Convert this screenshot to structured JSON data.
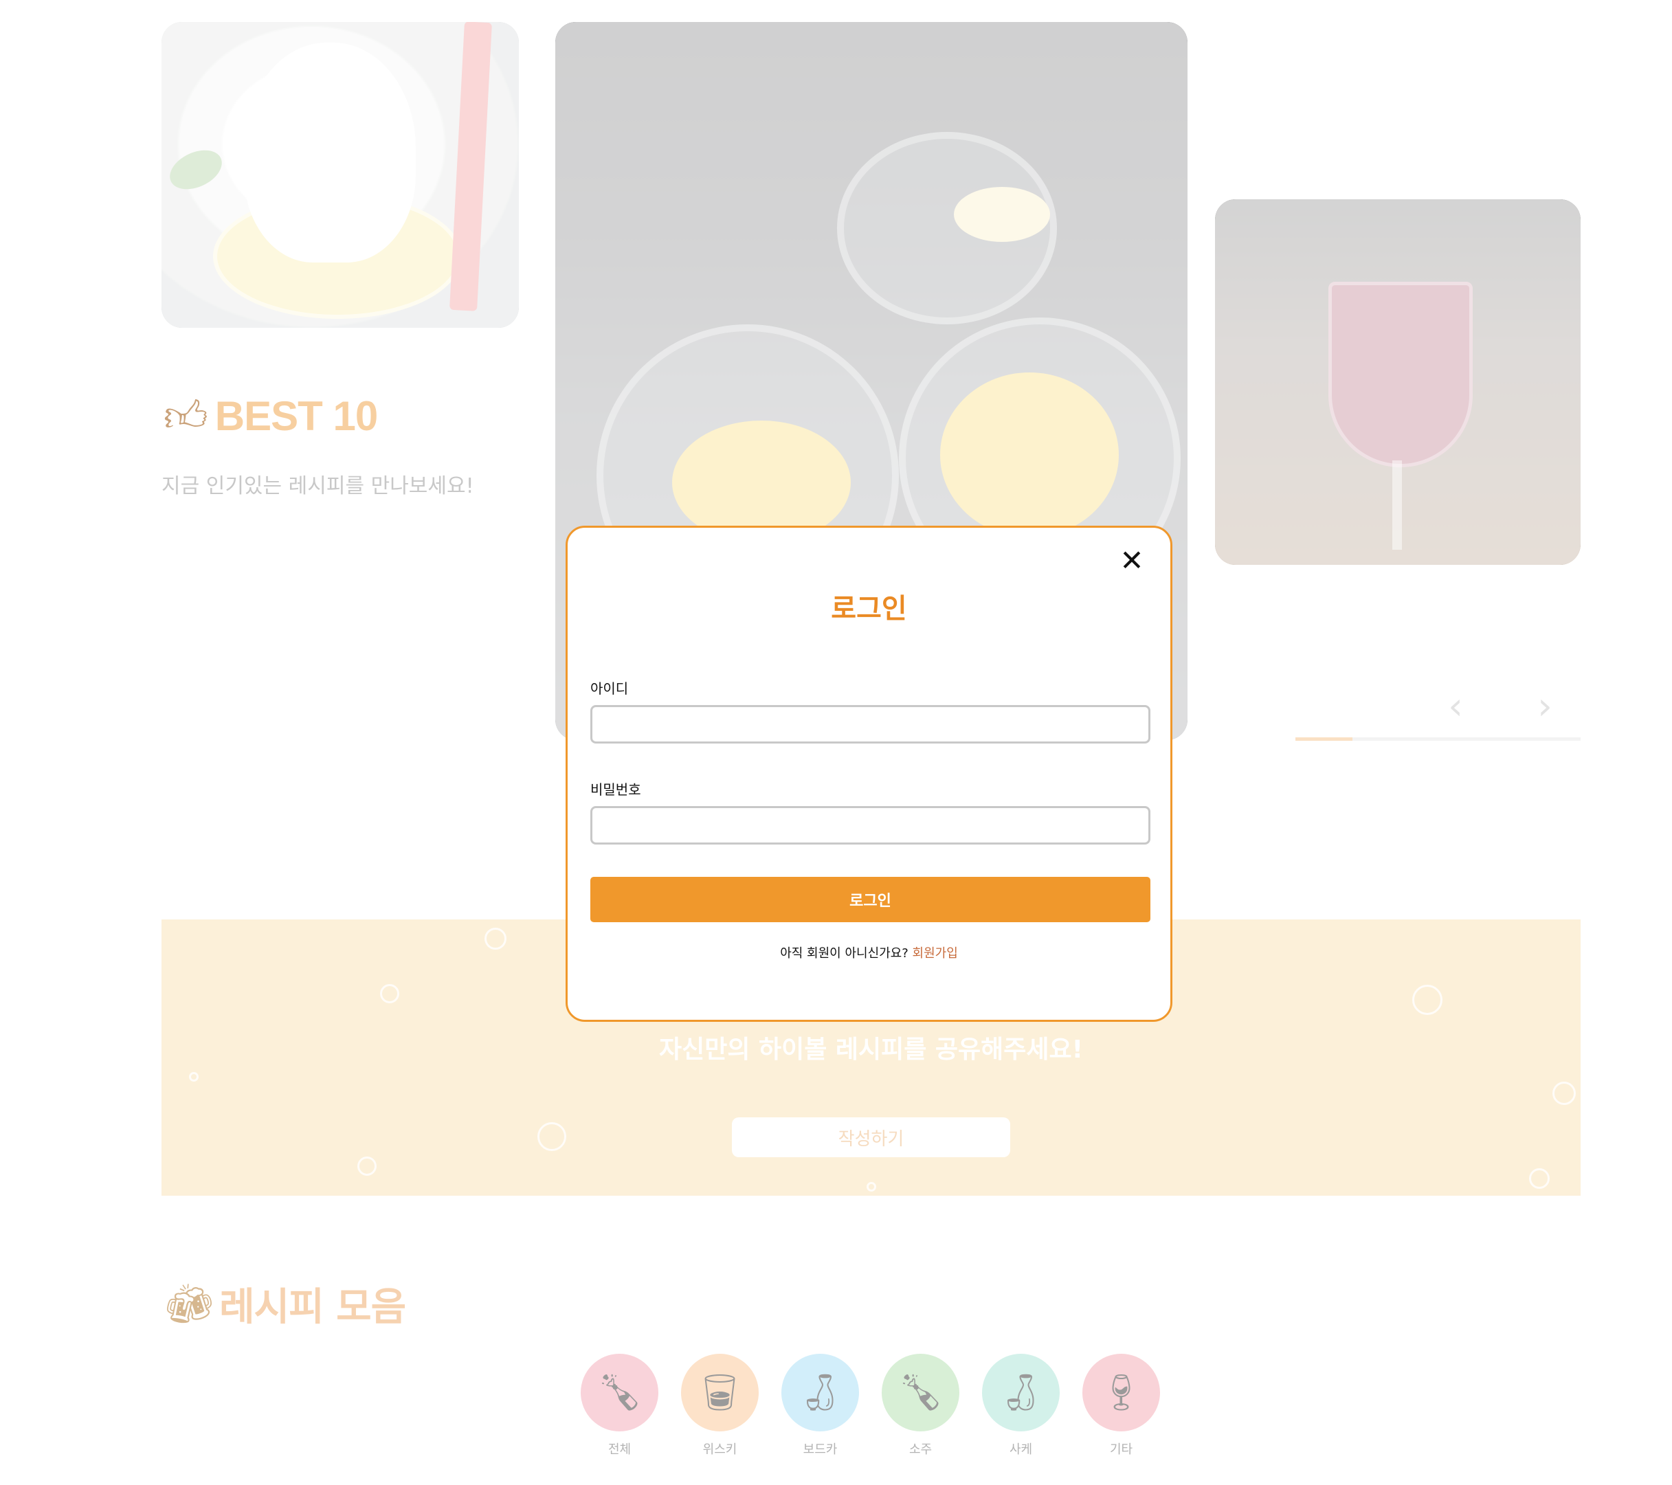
{
  "best": {
    "thumb_icon": "thumbs-up-icon",
    "title": "BEST 10",
    "subtitle": "지금 인기있는 레시피를 만나보세요!"
  },
  "carousel": {
    "prev_icon": "chevron-left-icon",
    "next_icon": "chevron-right-icon",
    "prev_glyph": "‹",
    "next_glyph": "›",
    "progress_fraction": 0.2
  },
  "banner": {
    "text": "자신만의 하이볼 레시피를 공유해주세요!",
    "button": "작성하기"
  },
  "recipes": {
    "icon": "beer-mugs-icon",
    "title": "레시피 모음",
    "categories": [
      {
        "label": "전체",
        "color": "#f9d3da",
        "icon": "all-bottles-icon"
      },
      {
        "label": "위스키",
        "color": "#fde2c9",
        "icon": "whiskey-bottle-icon"
      },
      {
        "label": "보드카",
        "color": "#d2eefa",
        "icon": "vodka-bottle-icon"
      },
      {
        "label": "소주",
        "color": "#d8efd6",
        "icon": "soju-bottle-icon"
      },
      {
        "label": "사케",
        "color": "#d3f1ea",
        "icon": "sake-bottle-icon"
      },
      {
        "label": "기타",
        "color": "#f9d3d8",
        "icon": "wine-bottle-icon"
      }
    ]
  },
  "modal": {
    "close_glyph": "✕",
    "title": "로그인",
    "id_label": "아이디",
    "id_value": "",
    "pw_label": "비밀번호",
    "pw_value": "",
    "submit": "로그인",
    "signup_prompt": "아직 회원이 아니신가요?",
    "signup_link": "회원가입"
  },
  "colors": {
    "accent": "#f0982c",
    "title_orange": "#ea8a24",
    "banner_bg": "#fcf0d9"
  }
}
